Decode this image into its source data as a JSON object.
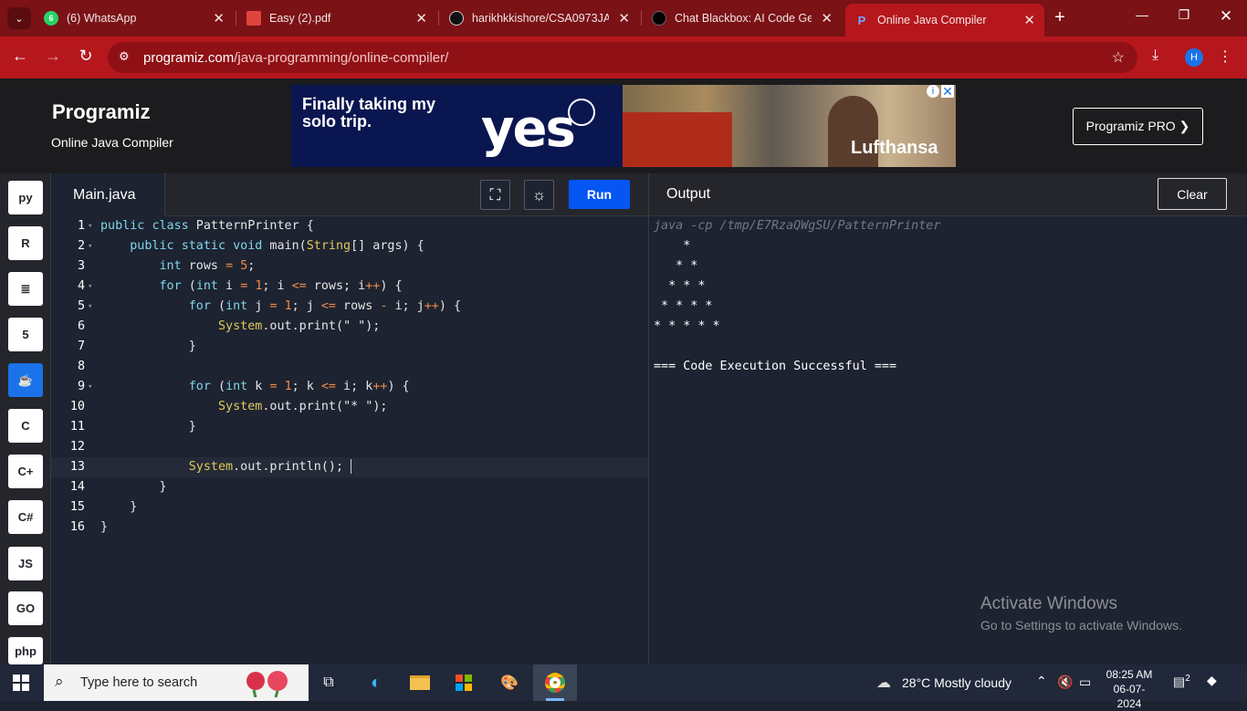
{
  "browser": {
    "tabs": [
      {
        "title": "(6) WhatsApp",
        "icon": "whatsapp-icon"
      },
      {
        "title": "Easy (2).pdf",
        "icon": "pdf-icon"
      },
      {
        "title": "harikhkkishore/CSA0973JAVA",
        "icon": "github-icon"
      },
      {
        "title": "Chat Blackbox: AI Code Gene",
        "icon": "blackbox-icon"
      },
      {
        "title": "Online Java Compiler",
        "icon": "programiz-icon"
      }
    ],
    "whatsapp_badge": "6",
    "url_host": "programiz.com",
    "url_path": "/java-programming/online-compiler/",
    "profile_initial": "H"
  },
  "header": {
    "logo": "Programiz",
    "subtitle": "Online Java Compiler",
    "pro_button": "Programiz PRO ❯"
  },
  "ad": {
    "headline": "Finally taking my solo trip.",
    "big_word": "yes",
    "brand": "Lufthansa"
  },
  "sidebar": {
    "languages": [
      {
        "name": "python-icon",
        "label": "py"
      },
      {
        "name": "r-icon",
        "label": "R"
      },
      {
        "name": "sql-icon",
        "label": "≣"
      },
      {
        "name": "html5-icon",
        "label": "5"
      },
      {
        "name": "java-icon",
        "label": "☕"
      },
      {
        "name": "c-icon",
        "label": "C"
      },
      {
        "name": "cpp-icon",
        "label": "C+"
      },
      {
        "name": "csharp-icon",
        "label": "C#"
      },
      {
        "name": "javascript-icon",
        "label": "JS"
      },
      {
        "name": "go-icon",
        "label": "GO"
      },
      {
        "name": "php-icon",
        "label": "php"
      }
    ]
  },
  "editor": {
    "file_tab": "Main.java",
    "run_label": "Run"
  },
  "output": {
    "title": "Output",
    "clear_label": "Clear",
    "command": "java -cp /tmp/E7RzaQWgSU/PatternPrinter",
    "lines": [
      "    *",
      "   * *",
      "  * * *",
      " * * * *",
      "* * * * *",
      "",
      "=== Code Execution Successful ==="
    ]
  },
  "watermark": {
    "line1": "Activate Windows",
    "line2": "Go to Settings to activate Windows."
  },
  "taskbar": {
    "search_placeholder": "Type here to search",
    "weather": "28°C  Mostly cloudy",
    "time": "08:25 AM",
    "date": "06-07-2024",
    "notification_count": "2"
  }
}
